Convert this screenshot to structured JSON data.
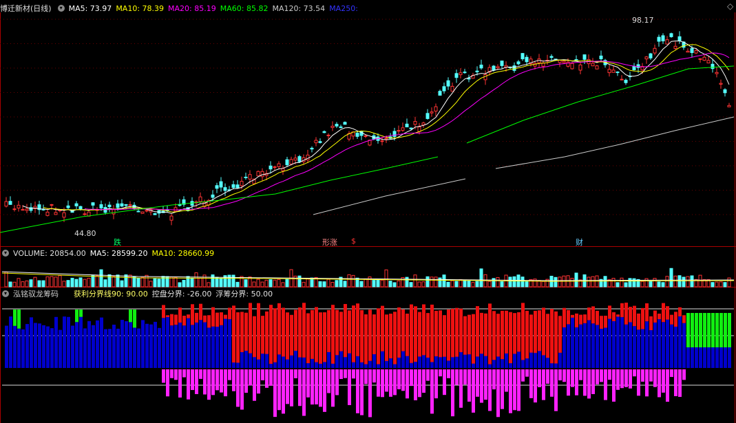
{
  "main_header": {
    "title": "博迁新材(日线)",
    "ma5": "MA5: 73.97",
    "ma10": "MA10: 78.39",
    "ma20": "MA20: 85.19",
    "ma60": "MA60: 85.82",
    "ma120": "MA120: 73.54",
    "ma250": "MA250:"
  },
  "volume_header": {
    "volume": "VOLUME: 20854.00",
    "ma5": "MA5: 28599.20",
    "ma10": "MA10: 28660.99"
  },
  "chip_header": {
    "title": "泓铭驭龙筹码",
    "profit": "获利分界线90: 90.00",
    "control": "控盘分界: -26.00",
    "float": "浮筹分界: 50.00"
  },
  "annotations": {
    "high": "98.17",
    "low": "44.80",
    "event1": "跌",
    "event2": "形涨",
    "event2b": "$",
    "event3": "财"
  },
  "colors": {
    "up": "#ff3333",
    "down": "#54ffff",
    "ma5": "#ffffff",
    "ma10": "#ffff00",
    "ma20": "#ff00ff",
    "ma60": "#00ff00",
    "ma120": "#cccccc",
    "ma250": "#3333ff",
    "chip_blue": "#0000cc",
    "chip_red": "#ee1111",
    "chip_green": "#11ee11",
    "chip_magenta": "#ff22ff"
  },
  "chart_data": [
    {
      "type": "candlestick",
      "title": "博迁新材(日线)",
      "price_min": 44.8,
      "price_max": 98.17,
      "series": [
        {
          "name": "MA5",
          "value": 73.97
        },
        {
          "name": "MA10",
          "value": 78.39
        },
        {
          "name": "MA20",
          "value": 85.19
        },
        {
          "name": "MA60",
          "value": 85.82
        },
        {
          "name": "MA120",
          "value": 73.54
        },
        {
          "name": "MA250",
          "value": null
        }
      ]
    },
    {
      "type": "bar",
      "title": "VOLUME",
      "volume": 20854.0,
      "series": [
        {
          "name": "MA5",
          "value": 28599.2
        },
        {
          "name": "MA10",
          "value": 28660.99
        }
      ]
    },
    {
      "type": "bar",
      "title": "泓铭驭龙筹码",
      "series": [
        {
          "name": "获利分界线90",
          "value": 90.0
        },
        {
          "name": "控盘分界",
          "value": -26.0
        },
        {
          "name": "浮筹分界",
          "value": 50.0
        }
      ]
    }
  ]
}
